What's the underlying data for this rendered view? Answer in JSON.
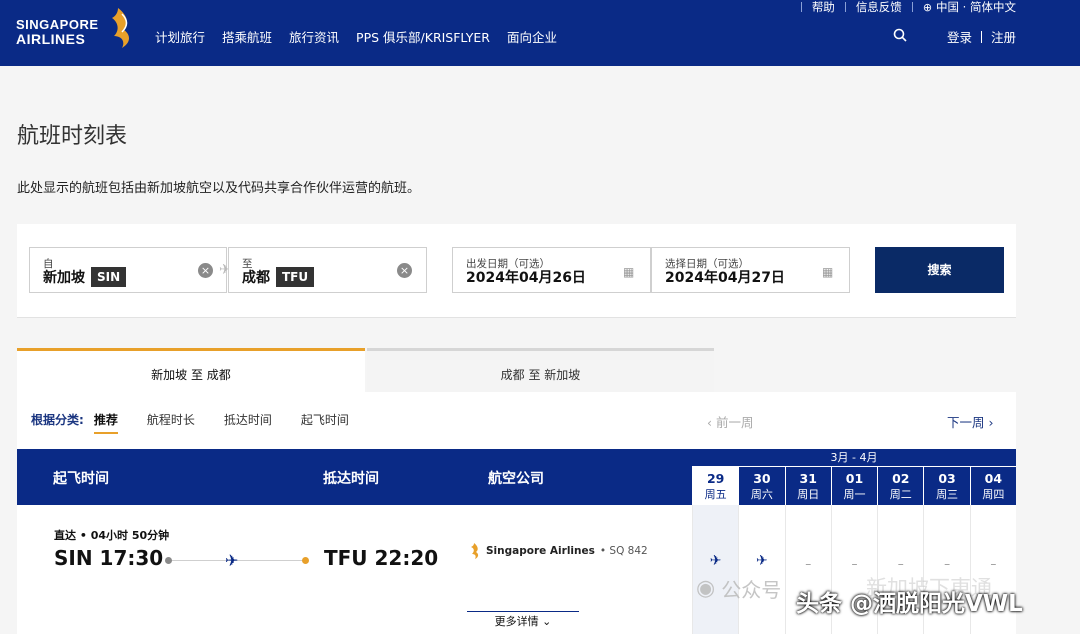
{
  "header": {
    "brand_line1": "SINGAPORE",
    "brand_line2": "AIRLINES",
    "nav": [
      "计划旅行",
      "搭乘航班",
      "旅行资讯",
      "PPS 俱乐部/KRISFLYER",
      "面向企业"
    ],
    "utility": {
      "help": "帮助",
      "feedback": "信息反馈",
      "locale": "中国 · 简体中文"
    },
    "login": "登录",
    "register": "注册"
  },
  "page": {
    "title": "航班时刻表",
    "description": "此处显示的航班包括由新加坡航空以及代码共享合作伙伴运营的航班。"
  },
  "search": {
    "from_label": "自",
    "from_city": "新加坡",
    "from_code": "SIN",
    "to_label": "至",
    "to_city": "成都",
    "to_code": "TFU",
    "depart_label": "出发日期（可选）",
    "depart_date": "2024年04月26日",
    "return_label": "选择日期（可选）",
    "return_date": "2024年04月27日",
    "search_button": "搜索"
  },
  "tabs": {
    "outbound": "新加坡 至 成都",
    "inbound": "成都 至 新加坡"
  },
  "sort": {
    "label": "根据分类:",
    "options": [
      "推荐",
      "航程时长",
      "抵达时间",
      "起飞时间"
    ]
  },
  "week": {
    "prev": "‹ 前一周",
    "next": "下一周 ›"
  },
  "table": {
    "col_depart": "起飞时间",
    "col_arrive": "抵达时间",
    "col_airline": "航空公司",
    "month_range": "3月 - 4月",
    "dates": [
      {
        "d": "29",
        "w": "周五",
        "selected": true,
        "mark": "plane"
      },
      {
        "d": "30",
        "w": "周六",
        "selected": false,
        "mark": "plane"
      },
      {
        "d": "31",
        "w": "周日",
        "selected": false,
        "mark": "–"
      },
      {
        "d": "01",
        "w": "周一",
        "selected": false,
        "mark": "–"
      },
      {
        "d": "02",
        "w": "周二",
        "selected": false,
        "mark": "–"
      },
      {
        "d": "03",
        "w": "周三",
        "selected": false,
        "mark": "–"
      },
      {
        "d": "04",
        "w": "周四",
        "selected": false,
        "mark": "–"
      }
    ]
  },
  "flight": {
    "meta": "直达 • 04小时 50分钟",
    "depart": "SIN 17:30",
    "arrive": "TFU 22:20",
    "airline": "Singapore Airlines",
    "flight_no": "• SQ 842",
    "more": "更多详情"
  },
  "watermark": {
    "left": "公众号",
    "right": "头条 @洒脱阳光VWL",
    "ghost": "新加坡下東通"
  },
  "colors": {
    "navy": "#0a2a86",
    "gold": "#e8a02a"
  }
}
